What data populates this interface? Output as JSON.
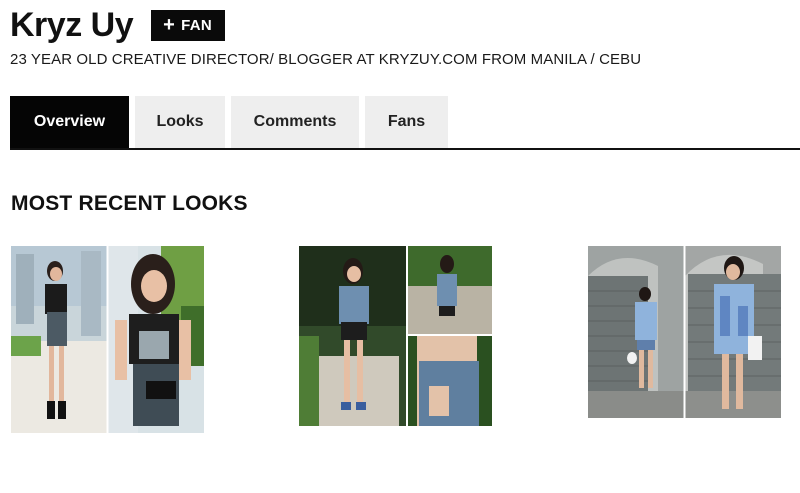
{
  "profile": {
    "name": "Kryz Uy",
    "fan_button_label": "FAN",
    "bio": "23 YEAR OLD CREATIVE DIRECTOR/ BLOGGER AT KRYZUY.COM FROM MANILA / CEBU"
  },
  "tabs": [
    {
      "label": "Overview",
      "active": true
    },
    {
      "label": "Looks",
      "active": false
    },
    {
      "label": "Comments",
      "active": false
    },
    {
      "label": "Fans",
      "active": false
    }
  ],
  "section": {
    "title": "MOST RECENT LOOKS"
  },
  "colors": {
    "tab_active_bg": "#050505",
    "tab_inactive_bg": "#eeeeee",
    "button_bg": "#0a0a0a"
  }
}
